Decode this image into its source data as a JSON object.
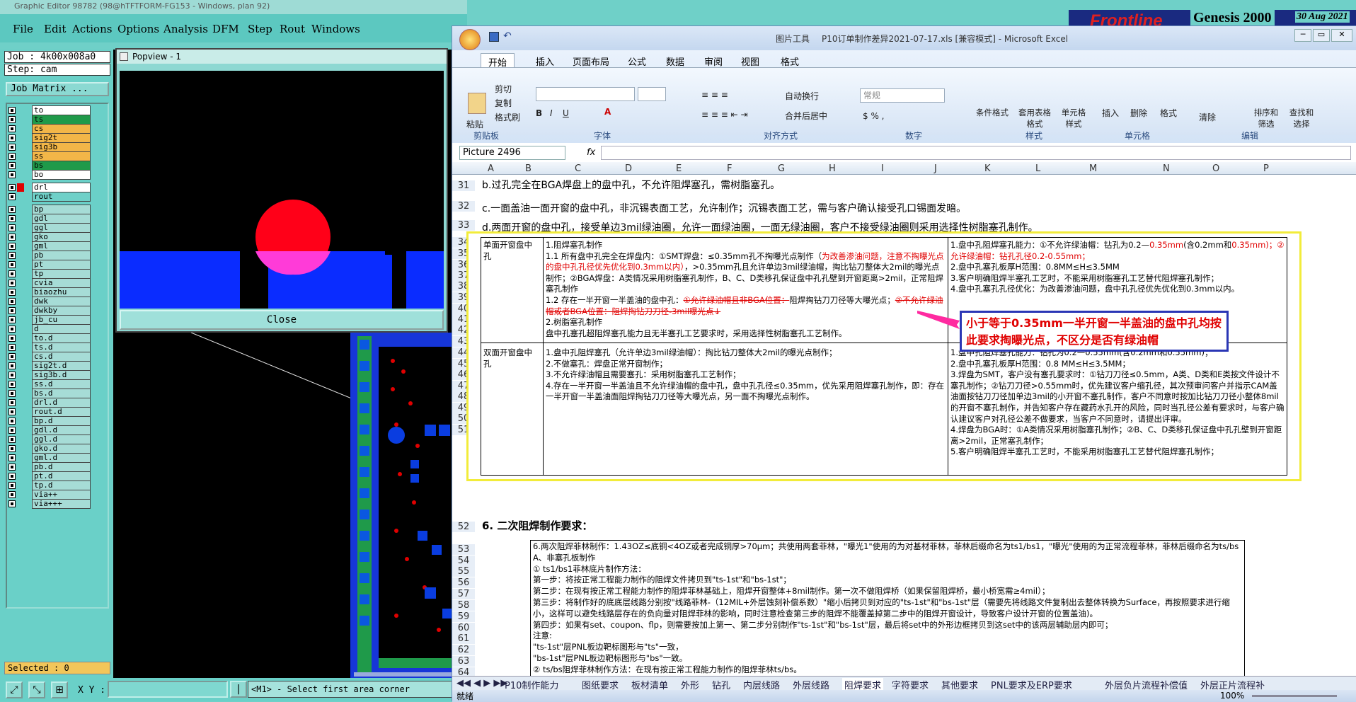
{
  "genesis": {
    "window_title": "Graphic Editor 98782 (98@hTFTFORM-FG153 - Windows, plan 92)",
    "menu": [
      "File",
      "Edit",
      "Actions",
      "Options",
      "Analysis",
      "DFM",
      "Step",
      "Rout",
      "Windows"
    ],
    "job": "Job : 4k00x008a0",
    "step": "Step: cam",
    "job_matrix": "Job Matrix ...",
    "layers": [
      {
        "name": "to",
        "color": "#ffffff"
      },
      {
        "name": "ts",
        "color": "#1f9a4a"
      },
      {
        "name": "cs",
        "color": "#f2b648"
      },
      {
        "name": "sig2t",
        "color": "#f2b648"
      },
      {
        "name": "sig3b",
        "color": "#f2b648"
      },
      {
        "name": "ss",
        "color": "#f2b648"
      },
      {
        "name": "bs",
        "color": "#1f9a4a"
      },
      {
        "name": "bo",
        "color": "#ffffff"
      },
      {
        "name": "drl",
        "color": "#ffffff"
      },
      {
        "name": "rout",
        "color": "#6fd0c8"
      },
      {
        "name": "bp",
        "color": "#a6dcd6"
      },
      {
        "name": "gdl",
        "color": "#a6dcd6"
      },
      {
        "name": "ggl",
        "color": "#a6dcd6"
      },
      {
        "name": "gko",
        "color": "#a6dcd6"
      },
      {
        "name": "gml",
        "color": "#a6dcd6"
      },
      {
        "name": "pb",
        "color": "#a6dcd6"
      },
      {
        "name": "pt",
        "color": "#a6dcd6"
      },
      {
        "name": "tp",
        "color": "#a6dcd6"
      },
      {
        "name": "cvia",
        "color": "#a6dcd6"
      },
      {
        "name": "biaozhu",
        "color": "#a6dcd6"
      },
      {
        "name": "dwk",
        "color": "#a6dcd6"
      },
      {
        "name": "dwkby",
        "color": "#a6dcd6"
      },
      {
        "name": "jb_cu",
        "color": "#a6dcd6"
      },
      {
        "name": "d",
        "color": "#a6dcd6"
      },
      {
        "name": "to.d",
        "color": "#a6dcd6"
      },
      {
        "name": "ts.d",
        "color": "#a6dcd6"
      },
      {
        "name": "cs.d",
        "color": "#a6dcd6"
      },
      {
        "name": "sig2t.d",
        "color": "#a6dcd6"
      },
      {
        "name": "sig3b.d",
        "color": "#a6dcd6"
      },
      {
        "name": "ss.d",
        "color": "#a6dcd6"
      },
      {
        "name": "bs.d",
        "color": "#a6dcd6"
      },
      {
        "name": "drl.d",
        "color": "#a6dcd6"
      },
      {
        "name": "rout.d",
        "color": "#a6dcd6"
      },
      {
        "name": "bp.d",
        "color": "#a6dcd6"
      },
      {
        "name": "gdl.d",
        "color": "#a6dcd6"
      },
      {
        "name": "ggl.d",
        "color": "#a6dcd6"
      },
      {
        "name": "gko.d",
        "color": "#a6dcd6"
      },
      {
        "name": "gml.d",
        "color": "#a6dcd6"
      },
      {
        "name": "pb.d",
        "color": "#a6dcd6"
      },
      {
        "name": "pt.d",
        "color": "#a6dcd6"
      },
      {
        "name": "tp.d",
        "color": "#a6dcd6"
      },
      {
        "name": "via++",
        "color": "#a6dcd6"
      },
      {
        "name": "via+++",
        "color": "#a6dcd6"
      }
    ],
    "selected": "Selected : 0",
    "xy_label": "X Y :",
    "status_msg": "<M1> - Select first area corner",
    "popview_title": "Popview - 1",
    "close_label": "Close",
    "brand": "Frontline",
    "product": "Genesis 2000",
    "date": "30 Aug 2021"
  },
  "excel": {
    "picture_tools": "图片工具",
    "title": "P10订单制作差异2021-07-17.xls  [兼容模式] - Microsoft Excel",
    "tabs": [
      "开始",
      "插入",
      "页面布局",
      "公式",
      "数据",
      "审阅",
      "视图",
      "格式"
    ],
    "clipboard": {
      "paste": "粘贴",
      "cut": "剪切",
      "copy": "复制",
      "format_painter": "格式刷",
      "label": "剪贴板"
    },
    "groups": {
      "font": "字体",
      "align": "对齐方式",
      "number": "数字",
      "style": "样式",
      "cells": "单元格",
      "edit": "编辑"
    },
    "buttons": {
      "wrap": "自动换行",
      "merge": "合并后居中",
      "number_format": "常规",
      "cond": "条件格式",
      "table": "套用表格格式",
      "cellstyle": "单元格样式",
      "insert": "插入",
      "delete": "删除",
      "format": "格式",
      "clear": "清除",
      "sort": "排序和筛选",
      "find": "查找和选择"
    },
    "name_box": "Picture 2496",
    "columns": [
      "A",
      "B",
      "C",
      "D",
      "E",
      "F",
      "G",
      "H",
      "I",
      "J",
      "K",
      "L",
      "M",
      "N",
      "O",
      "P"
    ],
    "rows": {
      "r31": "b.过孔完全在BGA焊盘上的盘中孔，不允许阻焊塞孔，需树脂塞孔。",
      "r32": "c.一面盖油一面开窗的盘中孔，非沉锡表面工艺，允许制作；沉锡表面工艺，需与客户确认接受孔口锡面发暗。",
      "r33": "d.两面开窗的盘中孔，接受单边3mil绿油圈，允许一面绿油圈，一面无绿油圈，客户不接受绿油圈则采用选择性树脂塞孔制作。"
    },
    "table1": {
      "label": "单面开窗盘中孔",
      "mid_1": "1.阻焊塞孔制作",
      "mid_2": "1.1 所有盘中孔完全在焊盘内：①SMT焊盘：≤0.35mm孔不掏曝光点制作（",
      "mid_2_red": "为改善渗油问题，注意不掏曝光点的盘中孔孔径优先优化到0.3mm以内）",
      "mid_3": "，>0.35mm孔且允许单边3mil绿油帽，掏比钻刀整体大2mil的曝光点制作；②BGA焊盘：A类情况采用树脂塞孔制作，B、C、D类移孔保证盘中孔孔壁到开窗距离>2mil，正常阻焊塞孔制作",
      "mid_4": "1.2 存在一半开窗一半盖油的盘中孔：",
      "mid_4_strike": "①允许绿油帽且非BGA位置：",
      "mid_4b": "阻焊掏钻刀刀径等大曝光点；",
      "mid_5_strike": "②不允许绿油帽或者BGA位置：阻焊掏钻刀刀径-3mil曝光点↓",
      "mid_6": "2.树脂塞孔制作",
      "mid_7": "盘中孔塞孔超阻焊塞孔能力且无半塞孔工艺要求时，采用选择性树脂塞孔工艺制作。",
      "right_1": "1.盘中孔阻焊塞孔能力：①不允许绿油帽：钻孔为0.2—",
      "right_1_red": "0.35mm",
      "right_1b": "(含0.2mm和",
      "right_1c_red": "0.35mm)；②允许绿油帽：钻孔孔径0.2-0.55mm；",
      "right_2": "2.盘中孔塞孔板厚H范围：0.8MM≤H≤3.5MM",
      "right_3": "3.客户明确阻焊半塞孔工艺时，不能采用树脂塞孔工艺替代阻焊塞孔制作；",
      "right_4": "4.盘中孔塞孔孔径优化：为改善渗油问题，盘中孔孔径优先优化到0.3mm以内。"
    },
    "table2": {
      "label": "双面开窗盘中孔",
      "mid": "1.盘中孔阻焊塞孔（允许单边3mil绿油帽）：掏比钻刀整体大2mil的曝光点制作；\n2.不做塞孔：焊盘正常开窗制作；\n3.不允许绿油帽且需要塞孔：采用树脂塞孔工艺制作；\n4.存在一半开窗一半盖油且不允许绿油帽的盘中孔，盘中孔孔径≤0.35mm，优先采用阻焊塞孔制作，即：存在一半开窗一半盖油面阻焊掏钻刀刀径等大曝光点，另一面不掏曝光点制作。",
      "right": "1.盘中孔阻焊塞孔能力：钻孔为0.2—0.55mm(含0.2mm和0.55mm)；\n2.盘中孔塞孔板厚H范围：0.8 MM≤H≤3.5MM；\n3.焊盘为SMT，客户没有塞孔要求时：①钻刀刀径≤0.5mm，A类、D类和E类按文件设计不塞孔制作；②钻刀刀径>0.55mm时，优先建议客户缩孔径，其次预审问客户并指示CAM盖油面按钻刀刀径加单边3mil的小开窗不塞孔制作，客户不同意时按加比钻刀刀径小整体8mil的开窗不塞孔制作，并告知客户存在藏药水孔开的风险，同时当孔径公差有要求时，与客户确认建议客户对孔径公差不做要求，当客户不同意时，请提出评审。\n4.焊盘为BGA时：①A类情况采用树脂塞孔制作；②B、C、D类移孔保证盘中孔孔壁到开窗距离>2mil，正常塞孔制作；\n5.客户明确阻焊半塞孔工艺时，不能采用树脂塞孔工艺替代阻焊塞孔制作；"
    },
    "callout": "小于等于0.35mm一半开窗一半盖油的盘中孔均按此要求掏曝光点，不区分是否有绿油帽",
    "section6": "6.  二次阻焊制作要求：",
    "sec6_lines": [
      "6.两次阻焊菲林制作：1.43OZ≤底铜<4OZ或者完成铜厚>70μm；共使用两套菲林，\"曝光1\"使用的为对基材菲林，菲林后缀命名为ts1/bs1，\"曝光\"使用的为正常流程菲林，菲林后缀命名为ts/bs",
      "A、非塞孔板制作",
      "① ts1/bs1菲林底片制作方法：",
      "第一步：将按正常工程能力制作的阻焊文件拷贝到\"ts-1st\"和\"bs-1st\"；",
      "第二步：在现有按正常工程能力制作的阻焊菲林基础上，阻焊开窗整体+8mil制作。第一次不做阻焊桥（如果保留阻焊桥，最小桥宽需≥4mil）；",
      "第三步：将制作好的底底层线路分别按\"线路菲林-（12MIL+外层蚀刻补偿系数）\"缩小后拷贝到对应的\"ts-1st\"和\"bs-1st\"层（需要先将线路文件复制出去整体转换为Surface，再按照要求进行缩小，这样可以避免线路层存在的负向量对阻焊菲林的影响，同时注意检查第三步的阻焊不能覆盖掉第二步中的阻焊开窗设计，导致客户设计开窗的位置盖油)。",
      "第四步：如果有set、coupon、flp，则需要按加上第一、第二步分别制作\"ts-1st\"和\"bs-1st\"层，最后将set中的外形边框拷贝到这set中的该两层辅助层内即可；",
      "注意:",
      "\"ts-1st\"层PNL板边靶标图形与\"ts\"一致，",
      "\"bs-1st\"层PNL板边靶标图形与\"bs\"一致。",
      "② ts/bs阻焊菲林制作方法：在现有按正常工程能力制作的阻焊菲林ts/bs。"
    ],
    "sheet_tabs": [
      "P10制作能力",
      "图纸要求",
      "板材清单",
      "外形",
      "钻孔",
      "内层线路",
      "外层线路",
      "阻焊要求",
      "字符要求",
      "其他要求",
      "PNL要求及ERP要求",
      "外层负片流程补偿值",
      "外层正片流程补"
    ],
    "status": "就绪",
    "zoom": "100%"
  }
}
